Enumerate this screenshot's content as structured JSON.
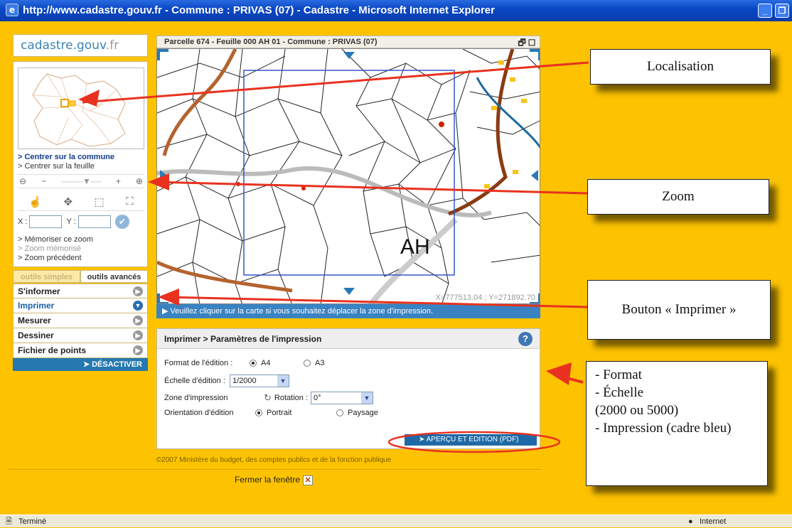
{
  "window": {
    "title": "http://www.cadastre.gouv.fr - Commune : PRIVAS (07) - Cadastre - Microsoft Internet Explorer",
    "minimize": "_",
    "restore": "❐"
  },
  "brand": {
    "logo_main": "cadastre.gouv",
    "logo_tld": ".fr"
  },
  "left": {
    "link_center_commune": "> Centrer sur la commune",
    "link_center_sheet": "> Centrer sur la feuille",
    "zoom_minus": "−",
    "zoom_plus": "+",
    "coord_x_label": "X :",
    "coord_y_label": "Y :",
    "memorize_zoom": "> Mémoriser ce zoom",
    "memorized_zoom": "> Zoom mémorisé",
    "previous_zoom": "> Zoom précédent"
  },
  "tabs": {
    "simple": "outils simples",
    "advanced": "outils avancés"
  },
  "menu": {
    "items": [
      {
        "label": "S'informer"
      },
      {
        "label": "Imprimer"
      },
      {
        "label": "Mesurer"
      },
      {
        "label": "Dessiner"
      },
      {
        "label": "Fichier de points"
      }
    ],
    "deactivate": "➤ DÉSACTIVER"
  },
  "map": {
    "title": "Parcelle 674 - Feuille 000 AH 01 - Commune : PRIVAS (07)",
    "section_label": "AH",
    "coordinates": "X=777513.04 ; Y=271892.70",
    "info": "▶ Veuillez cliquer sur la carte si vous souhaitez déplacer la zone d'impression."
  },
  "print": {
    "header": "Imprimer > Paramètres de l'impression",
    "help": "?",
    "format_label": "Format de l'édition :",
    "format_a4": "A4",
    "format_a3": "A3",
    "scale_label": "Échelle d'édition :",
    "scale_value": "1/2000",
    "zone_label": "Zone d'impression",
    "rotation_label": "Rotation :",
    "rotation_value": "0°",
    "orientation_label": "Orientation d'édition",
    "portrait": "Portrait",
    "paysage": "Paysage",
    "preview_button": "➤ APERÇU ET EDITION (PDF)"
  },
  "footer": {
    "copyright": "©2007 Ministère du budget, des comptes publics et de la fonction publique",
    "close_window": "Fermer la fenêtre"
  },
  "status": {
    "left": "Terminé",
    "right": "Internet"
  },
  "callouts": {
    "localisation": "Localisation",
    "zoom": "Zoom",
    "imprimer": "Bouton « Imprimer »",
    "format_list": "- Format\n- Échelle\n(2000 ou 5000)\n- Impression (cadre bleu)"
  },
  "colors": {
    "page_bg": "#fdc300",
    "titlebar": "#0a47c4",
    "accent_blue": "#2579b0",
    "arrow_red": "#e8321f"
  }
}
